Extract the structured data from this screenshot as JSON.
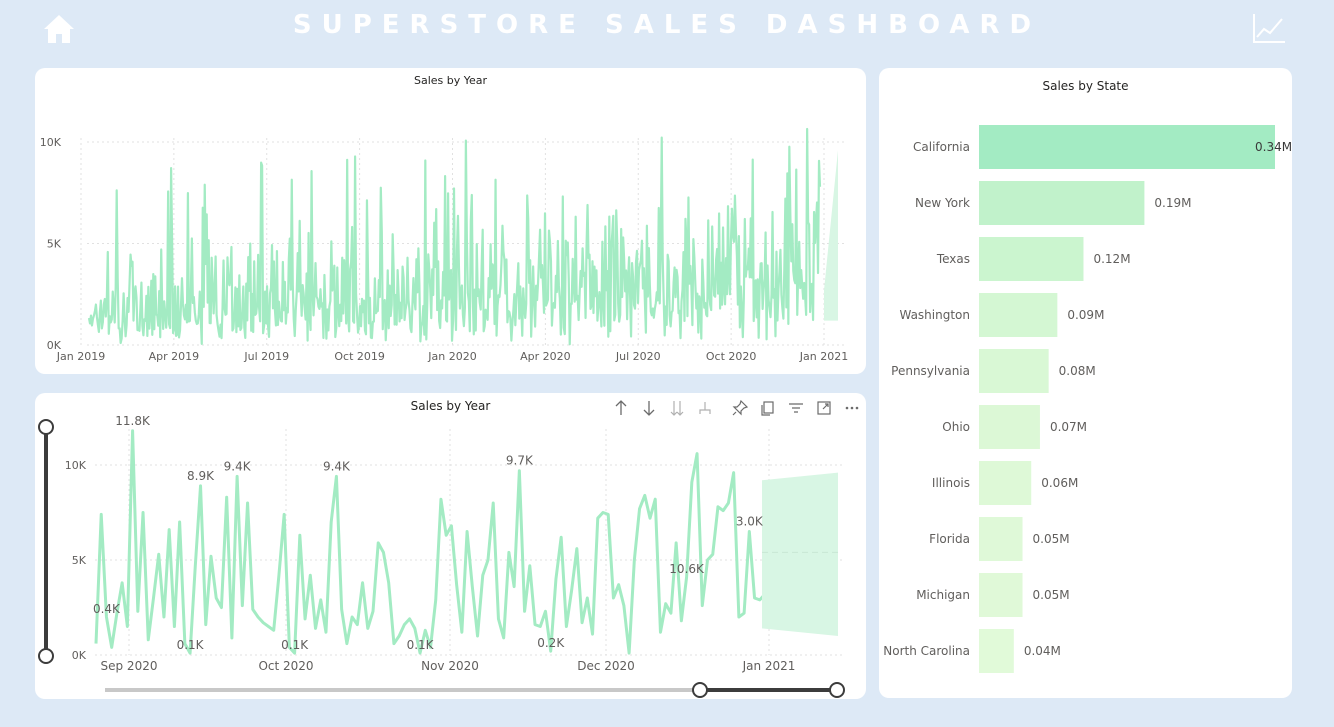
{
  "header": {
    "title": "SUPERSTORE SALES DASHBOARD",
    "home_icon": "home-icon",
    "chart_icon": "line-chart-icon",
    "accent": "#a3ebc3"
  },
  "top_chart": {
    "title": "Sales by Year"
  },
  "bottom_chart": {
    "title": "Sales by Year",
    "toolbar": [
      "arrow-up-icon",
      "arrow-down-icon",
      "double-arrow-down-icon",
      "expand-hierarchy-icon",
      "pin-icon",
      "copy-icon",
      "filter-icon",
      "focus-mode-icon",
      "more-options-icon"
    ]
  },
  "state_chart": {
    "title": "Sales by State"
  },
  "chart_data": [
    {
      "type": "line",
      "title": "Sales by Year",
      "xlabel": "",
      "ylabel": "",
      "x_range": [
        "2019-01-01",
        "2021-01-01"
      ],
      "ylim": [
        0,
        10000
      ],
      "yticks": [
        {
          "v": 0,
          "label": "0K"
        },
        {
          "v": 5000,
          "label": "5K"
        },
        {
          "v": 10000,
          "label": "10K"
        }
      ],
      "xticks": [
        "Jan 2019",
        "Apr 2019",
        "Jul 2019",
        "Oct 2019",
        "Jan 2020",
        "Apr 2020",
        "Jul 2020",
        "Oct 2020",
        "Jan 2021"
      ],
      "grid": true,
      "series": [
        {
          "color": "#a3ebc3",
          "seed": 7,
          "points": 740,
          "max": 11800
        }
      ],
      "forecast": {
        "from": [
          2700,
          1200
        ],
        "to": [
          9600,
          1200
        ]
      }
    },
    {
      "type": "line",
      "title": "Sales by Year",
      "xlabel": "",
      "ylabel": "",
      "ylim": [
        0,
        10000
      ],
      "yticks": [
        {
          "v": 0,
          "label": "0K"
        },
        {
          "v": 5000,
          "label": "5K"
        },
        {
          "v": 10000,
          "label": "10K"
        }
      ],
      "xticks": [
        "Sep 2020",
        "Oct 2020",
        "Nov 2020",
        "Dec 2020",
        "Jan 2021"
      ],
      "grid": true,
      "series": [
        {
          "color": "#a3ebc3",
          "values": [
            600,
            7400,
            2000,
            400,
            2200,
            3800,
            1500,
            11800,
            2300,
            7500,
            800,
            3000,
            5300,
            2000,
            6600,
            1500,
            7000,
            600,
            100,
            4700,
            8900,
            1600,
            5200,
            3000,
            2500,
            8300,
            900,
            9400,
            2600,
            8000,
            2400,
            2000,
            1700,
            1500,
            1300,
            4200,
            7400,
            400,
            100,
            6300,
            1900,
            4200,
            1400,
            2900,
            1200,
            7000,
            9400,
            2400,
            600,
            2000,
            1600,
            3800,
            1400,
            2300,
            5900,
            5400,
            3800,
            600,
            1000,
            1600,
            1900,
            1400,
            100,
            1300,
            400,
            2900,
            8200,
            6300,
            6800,
            3700,
            1200,
            6500,
            3600,
            1000,
            4200,
            5000,
            8000,
            1900,
            900,
            5400,
            3600,
            9700,
            2300,
            4700,
            1600,
            1500,
            2300,
            200,
            4000,
            6200,
            1500,
            3400,
            5600,
            1700,
            3000,
            1100,
            7200,
            7500,
            7400,
            3000,
            3700,
            2600,
            100,
            5000,
            7700,
            8400,
            7200,
            8200,
            1200,
            2700,
            2200,
            5900,
            1800,
            4100,
            9100,
            10600,
            2600,
            5000,
            5300,
            7800,
            7600,
            8000,
            9600,
            2000,
            2200,
            6500,
            3000,
            2900,
            3200
          ]
        }
      ],
      "data_labels": [
        {
          "i": 2,
          "label": "0.4K"
        },
        {
          "i": 7,
          "label": "11.8K"
        },
        {
          "i": 18,
          "label": "0.1K"
        },
        {
          "i": 20,
          "label": "8.9K"
        },
        {
          "i": 27,
          "label": "9.4K"
        },
        {
          "i": 38,
          "label": "0.1K"
        },
        {
          "i": 46,
          "label": "9.4K"
        },
        {
          "i": 62,
          "label": "0.1K"
        },
        {
          "i": 81,
          "label": "9.7K"
        },
        {
          "i": 87,
          "label": "0.2K"
        },
        {
          "i": 113,
          "label": "10.6K"
        },
        {
          "i": 125,
          "label": "3.0K"
        }
      ],
      "forecast": {
        "from": [
          9200,
          1400
        ],
        "to": [
          9600,
          1000
        ]
      }
    },
    {
      "type": "bar",
      "orientation": "horizontal",
      "title": "Sales by State",
      "xlabel": "",
      "ylabel": "",
      "categories": [
        "California",
        "New York",
        "Texas",
        "Washington",
        "Pennsylvania",
        "Ohio",
        "Illinois",
        "Florida",
        "Michigan",
        "North Carolina"
      ],
      "values": [
        0.34,
        0.19,
        0.12,
        0.09,
        0.08,
        0.07,
        0.06,
        0.05,
        0.05,
        0.04
      ],
      "labels": [
        "0.34M",
        "0.19M",
        "0.12M",
        "0.09M",
        "0.08M",
        "0.07M",
        "0.06M",
        "0.05M",
        "0.05M",
        "0.04M"
      ],
      "colors": [
        "#a3ebc3",
        "#c1f2cb",
        "#cbf5cf",
        "#d4f7d3",
        "#d9f8d5",
        "#dcf8d6",
        "#def9d7",
        "#dff9d8",
        "#e0f9d8",
        "#e1faD9"
      ]
    }
  ]
}
